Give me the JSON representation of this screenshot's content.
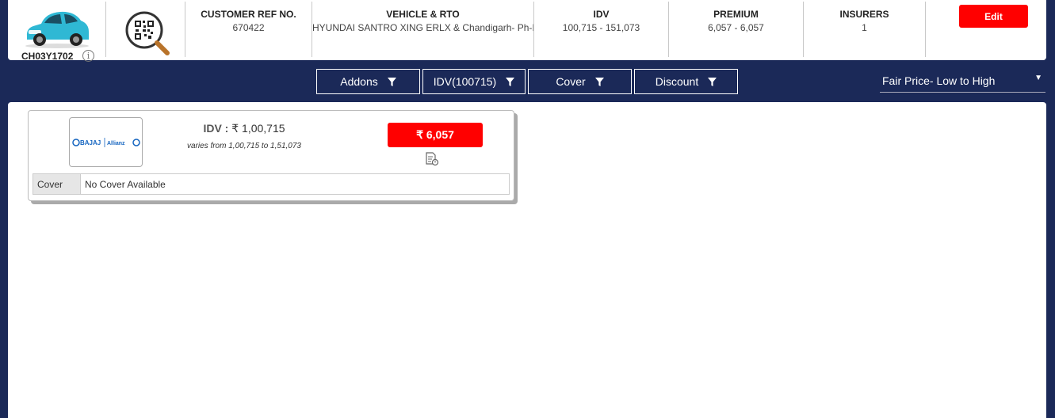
{
  "vehicle": {
    "plate": "CH03Y1702",
    "info_glyph": "i",
    "car_icon": "car-icon",
    "car_color": "#2fb8d4"
  },
  "summary": {
    "customer_ref": {
      "label": "CUSTOMER REF No.",
      "value": "670422"
    },
    "vehicle_rto": {
      "label": "VEHICLE & RTO",
      "value": "HYUNDAI SANTRO XING ERLX & Chandigarh- Ph-I"
    },
    "idv": {
      "label": "IDV",
      "value": "100,715 - 151,073"
    },
    "premium": {
      "label": "PREMIUM",
      "value": "6,057 - 6,057"
    },
    "insurers": {
      "label": "INSURERS",
      "value": "1"
    },
    "edit_label": "Edit"
  },
  "filters": [
    {
      "label": "Addons"
    },
    {
      "label": "IDV(100715)"
    },
    {
      "label": "Cover"
    },
    {
      "label": "Discount"
    }
  ],
  "sort": {
    "selected": "Fair Price- Low to High",
    "arrow": "▼"
  },
  "quotes": [
    {
      "insurer_logo_text": "BAJAJ | Allianz",
      "idv_label": "IDV :",
      "idv_value": "₹ 1,00,715",
      "idv_range": "varies from 1,00,715 to 1,51,073",
      "premium": "₹ 6,057",
      "cover_label": "Cover",
      "cover_value": "No Cover Available"
    }
  ],
  "colors": {
    "navy": "#1b2958",
    "accent_red": "#ff0000",
    "bajaj_blue": "#1565c0"
  }
}
